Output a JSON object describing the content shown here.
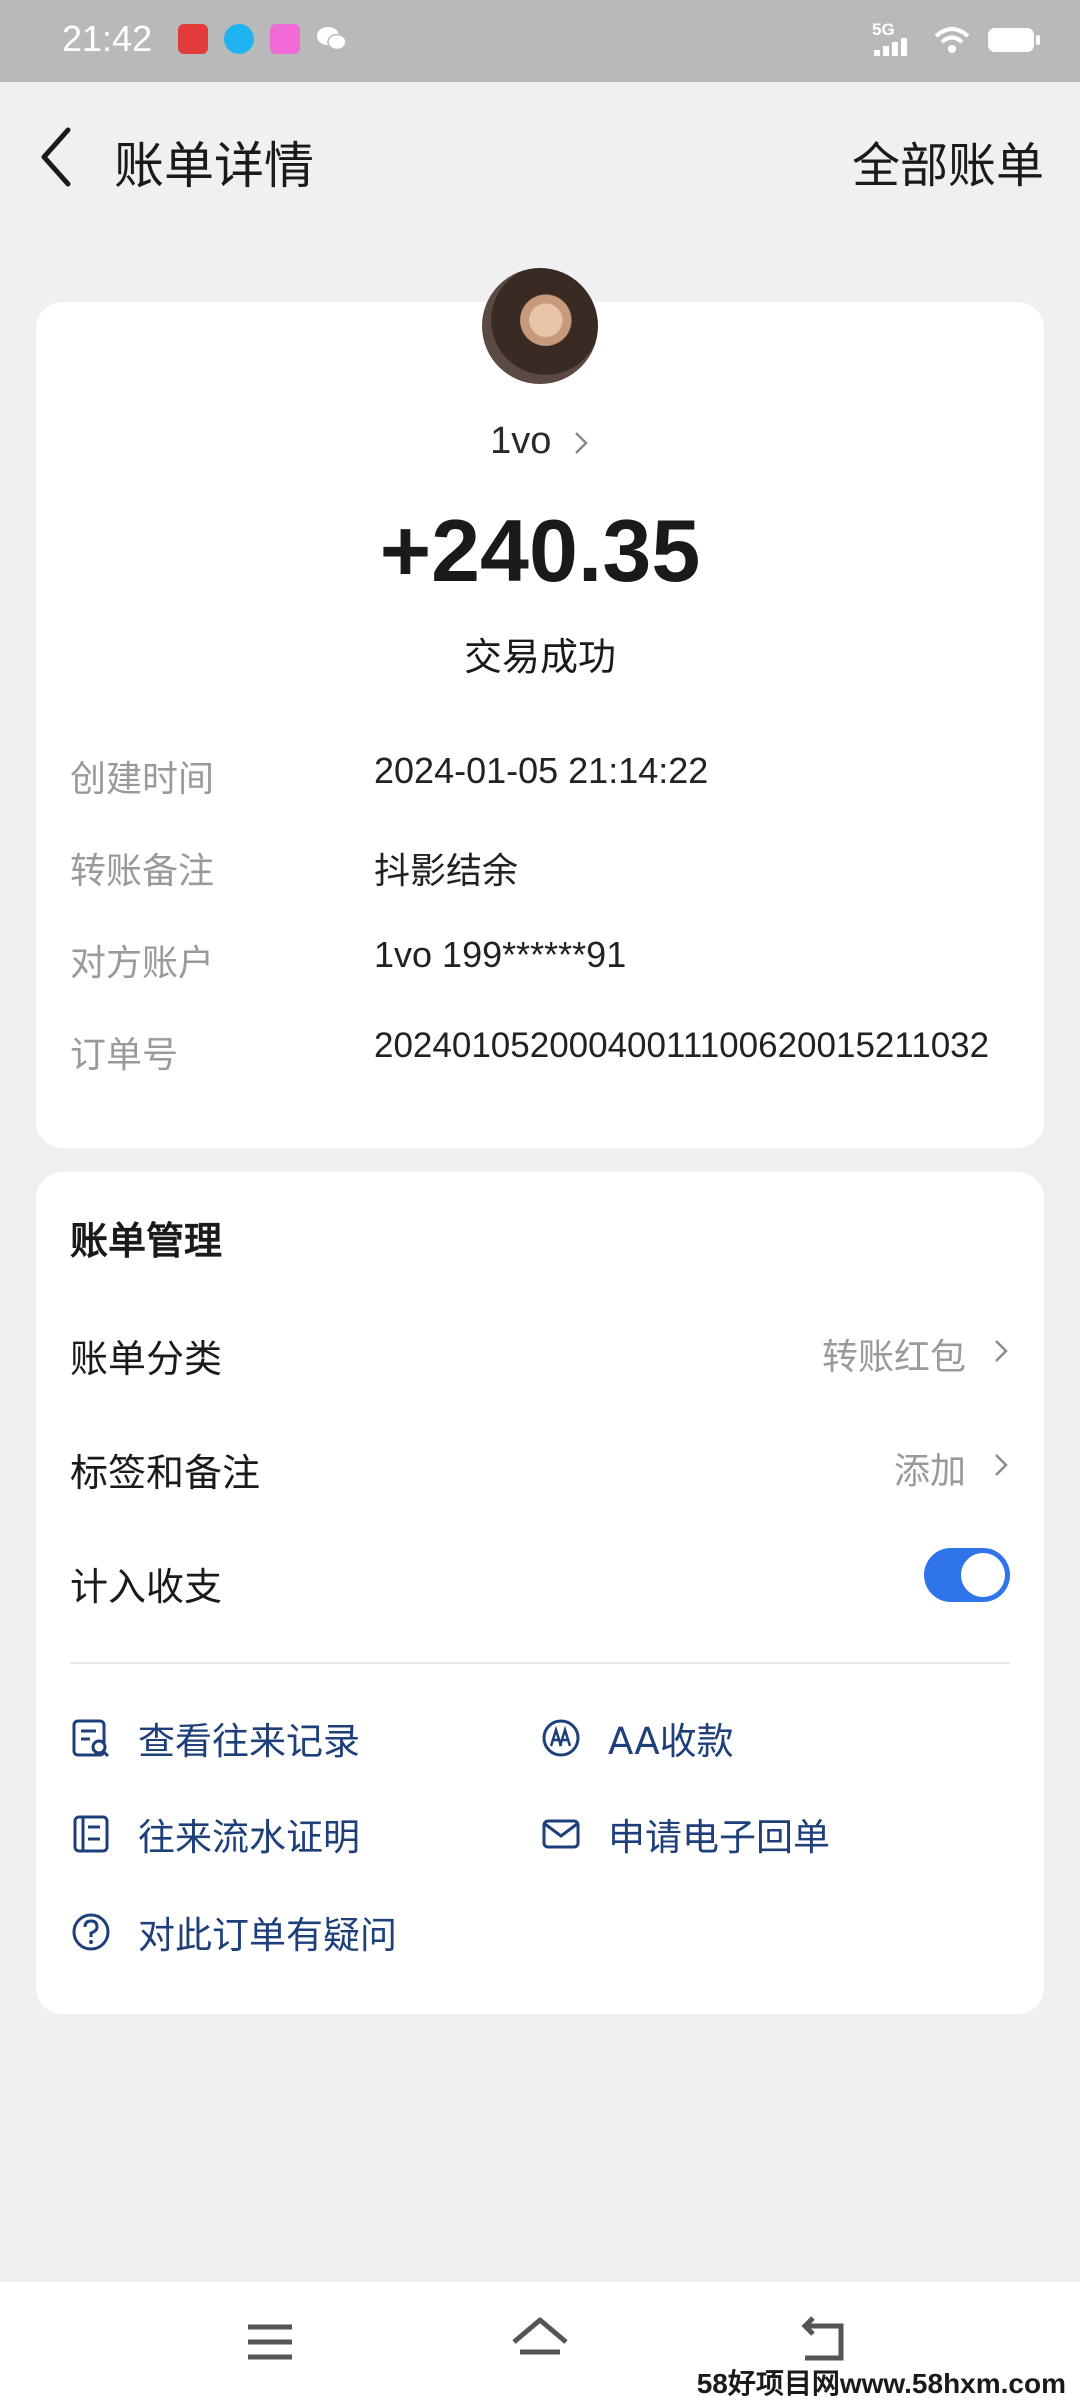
{
  "status_bar": {
    "time": "21:42",
    "network": "5G"
  },
  "header": {
    "title": "账单详情",
    "right_link": "全部账单"
  },
  "detail": {
    "counterparty": "1vo",
    "amount": "+240.35",
    "status": "交易成功",
    "rows": [
      {
        "label": "创建时间",
        "value": "2024-01-05 21:14:22"
      },
      {
        "label": "转账备注",
        "value": "抖影结余"
      },
      {
        "label": "对方账户",
        "value": "1vo 199******91"
      },
      {
        "label": "订单号",
        "value": "20240105200040011100620015211032"
      }
    ]
  },
  "manage": {
    "title": "账单管理",
    "category": {
      "label": "账单分类",
      "value": "转账红包"
    },
    "tags": {
      "label": "标签和备注",
      "value": "添加"
    },
    "count_in": {
      "label": "计入收支",
      "enabled": true
    },
    "actions": [
      {
        "label": "查看往来记录",
        "icon": "record-search-icon"
      },
      {
        "label": "AA收款",
        "icon": "aa-icon"
      },
      {
        "label": "往来流水证明",
        "icon": "document-icon"
      },
      {
        "label": "申请电子回单",
        "icon": "envelope-icon"
      },
      {
        "label": "对此订单有疑问",
        "icon": "question-icon"
      }
    ]
  },
  "watermark": "58好项目网www.58hxm.com",
  "colors": {
    "accent": "#2f74ea",
    "link": "#1f3f7a",
    "background": "#f0f0f2"
  }
}
